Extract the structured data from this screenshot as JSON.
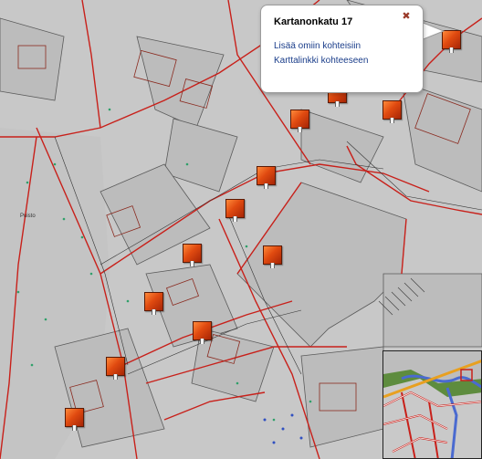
{
  "popup": {
    "title": "Kartanonkatu 17",
    "close_label": "✖",
    "links": [
      "Lisää omiin kohteisiin",
      "Karttalinkki kohteeseen"
    ]
  },
  "map_labels": {
    "puisto": "Puisto"
  },
  "colors": {
    "block_fill": "#bdbdbd",
    "street_red": "#c8201a",
    "park_bg": "#c6c6c6",
    "marker": "#e04a10"
  },
  "markers": [
    "address-marker",
    "address-marker",
    "address-marker",
    "address-marker",
    "address-marker",
    "address-marker",
    "address-marker",
    "address-marker",
    "address-marker",
    "address-marker",
    "address-marker",
    "address-marker"
  ]
}
